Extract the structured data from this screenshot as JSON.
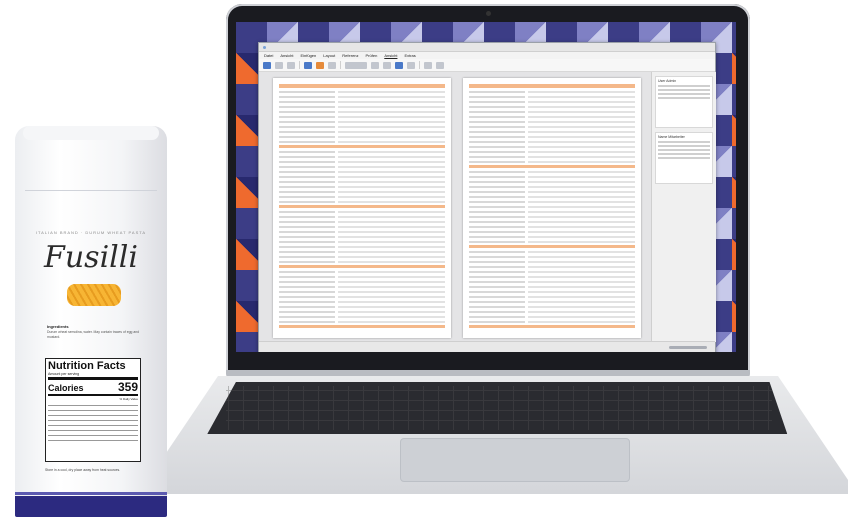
{
  "app": {
    "title": "",
    "menus": [
      "Datei",
      "Ansicht",
      "Einfügen",
      "Layout",
      "Referenz",
      "Prüfen",
      "Ansicht",
      "Extras"
    ],
    "active_menu_index": 6
  },
  "comments": [
    {
      "author": "User Admin"
    },
    {
      "author": "Name Mitarbeiter"
    }
  ],
  "colors": {
    "accent_orange": "#f4b88a",
    "app_blue": "#4a79c8",
    "bag_navy": "#2c2a80",
    "pasta_gold": "#f7b534"
  },
  "pasta_bag": {
    "brand_line": "ITALIAN BRAND · DURUM WHEAT PASTA",
    "product": "Fusilli",
    "ingredients_title": "Ingredients",
    "ingredients_text": "Durum wheat semolina, water. May contain traces of egg and mustard.",
    "nutrition": {
      "title": "Nutrition Facts",
      "serving": "Amount per serving",
      "calories_label": "Calories",
      "calories_value": "359",
      "dv_label": "% Daily Value"
    },
    "footer_note": "Store in a cool, dry place away from heat sources."
  }
}
